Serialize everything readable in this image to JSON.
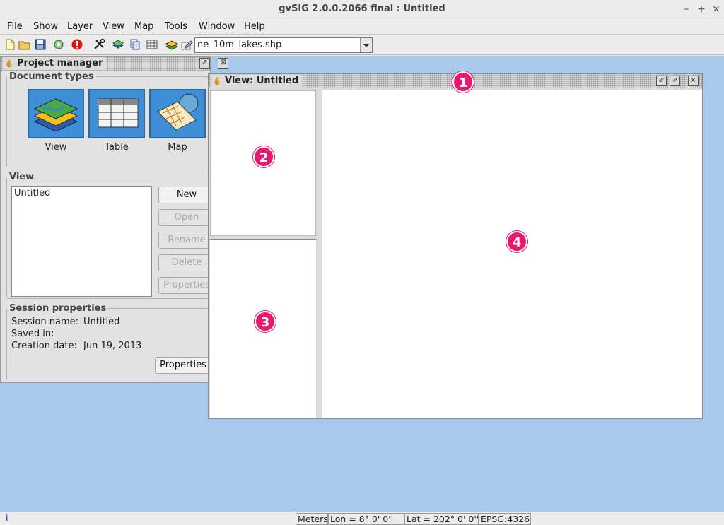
{
  "window": {
    "title": "gvSIG 2.0.0.2066 final : Untitled",
    "minimize": "–",
    "maximize": "+",
    "close": "×"
  },
  "menubar": [
    "File",
    "Show",
    "Layer",
    "View",
    "Map",
    "Tools",
    "Window",
    "Help"
  ],
  "toolbar": {
    "icons": [
      "new-project-icon",
      "open-project-icon",
      "save-project-icon",
      "settings-icon",
      "error-icon",
      "tools-icon",
      "add-layer-icon",
      "copy-icon",
      "table-icon",
      "layers-icon",
      "edit-icon"
    ],
    "layer_select": "ne_10m_lakes.shp"
  },
  "project_manager": {
    "title": "Project manager",
    "document_types_legend": "Document types",
    "doc_types": [
      "View",
      "Table",
      "Map"
    ],
    "view_legend": "View",
    "view_list": [
      "Untitled"
    ],
    "buttons": [
      "New",
      "Open",
      "Rename",
      "Delete",
      "Properties"
    ],
    "session_legend": "Session properties",
    "session_name_label": "Session name:",
    "session_name_value": "Untitled",
    "saved_in_label": "Saved in:",
    "saved_in_value": "",
    "creation_date_label": "Creation date:",
    "creation_date_value": "Jun 19, 2013",
    "properties_button": "Properties"
  },
  "view_window": {
    "title": "View: Untitled"
  },
  "markers": [
    "1",
    "2",
    "3",
    "4"
  ],
  "statusbar": {
    "info": "i",
    "units": "Meters",
    "lon": "Lon = 8° 0' 0''",
    "lat": "Lat = 202° 0' 0''",
    "crs": "EPSG:4326"
  },
  "colors": {
    "desktop": "#a8c8ec",
    "marker": "#e8186c",
    "doc_icon": "#3d8ed6"
  }
}
